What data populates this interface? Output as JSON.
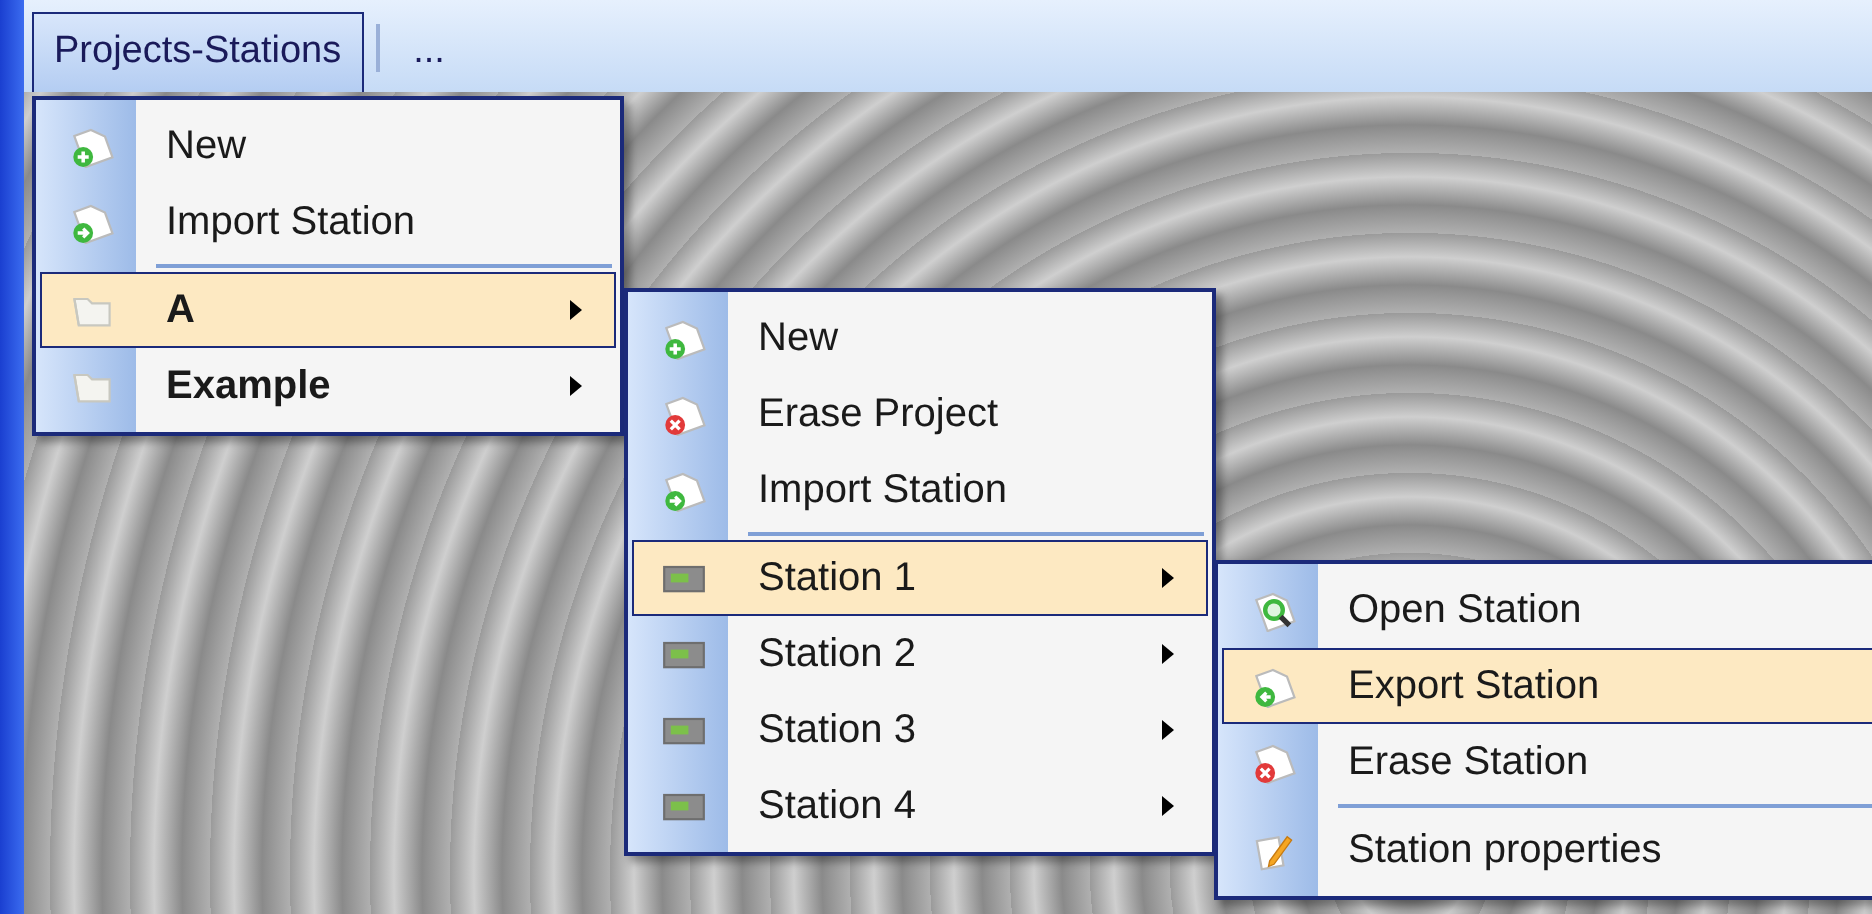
{
  "menubar": {
    "items": [
      {
        "label": "Projects-Stations",
        "selected": true
      },
      {
        "label": "...",
        "selected": false
      }
    ]
  },
  "menus": [
    {
      "items": [
        {
          "kind": "new",
          "label": "New",
          "selected": false,
          "submenu": false,
          "separator_before": false
        },
        {
          "kind": "import",
          "label": "Import Station",
          "selected": false,
          "submenu": false,
          "separator_before": false
        },
        {
          "kind": "project",
          "label": "A",
          "selected": true,
          "submenu": true,
          "separator_before": true
        },
        {
          "kind": "project",
          "label": "Example",
          "selected": false,
          "submenu": true,
          "separator_before": false
        }
      ]
    },
    {
      "items": [
        {
          "kind": "new",
          "label": "New",
          "selected": false,
          "submenu": false,
          "separator_before": false
        },
        {
          "kind": "erase",
          "label": "Erase Project",
          "selected": false,
          "submenu": false,
          "separator_before": false
        },
        {
          "kind": "import",
          "label": "Import Station",
          "selected": false,
          "submenu": false,
          "separator_before": false
        },
        {
          "kind": "station",
          "label": "Station 1",
          "selected": true,
          "submenu": true,
          "separator_before": true
        },
        {
          "kind": "station",
          "label": "Station 2",
          "selected": false,
          "submenu": true,
          "separator_before": false
        },
        {
          "kind": "station",
          "label": "Station 3",
          "selected": false,
          "submenu": true,
          "separator_before": false
        },
        {
          "kind": "station",
          "label": "Station 4",
          "selected": false,
          "submenu": true,
          "separator_before": false
        }
      ]
    },
    {
      "items": [
        {
          "kind": "open",
          "label": "Open Station",
          "selected": false,
          "submenu": false,
          "separator_before": false
        },
        {
          "kind": "export",
          "label": "Export Station",
          "selected": true,
          "submenu": false,
          "separator_before": false
        },
        {
          "kind": "erase",
          "label": "Erase Station",
          "selected": false,
          "submenu": false,
          "separator_before": false
        },
        {
          "kind": "properties",
          "label": "Station properties",
          "selected": false,
          "submenu": false,
          "separator_before": true
        }
      ]
    }
  ]
}
